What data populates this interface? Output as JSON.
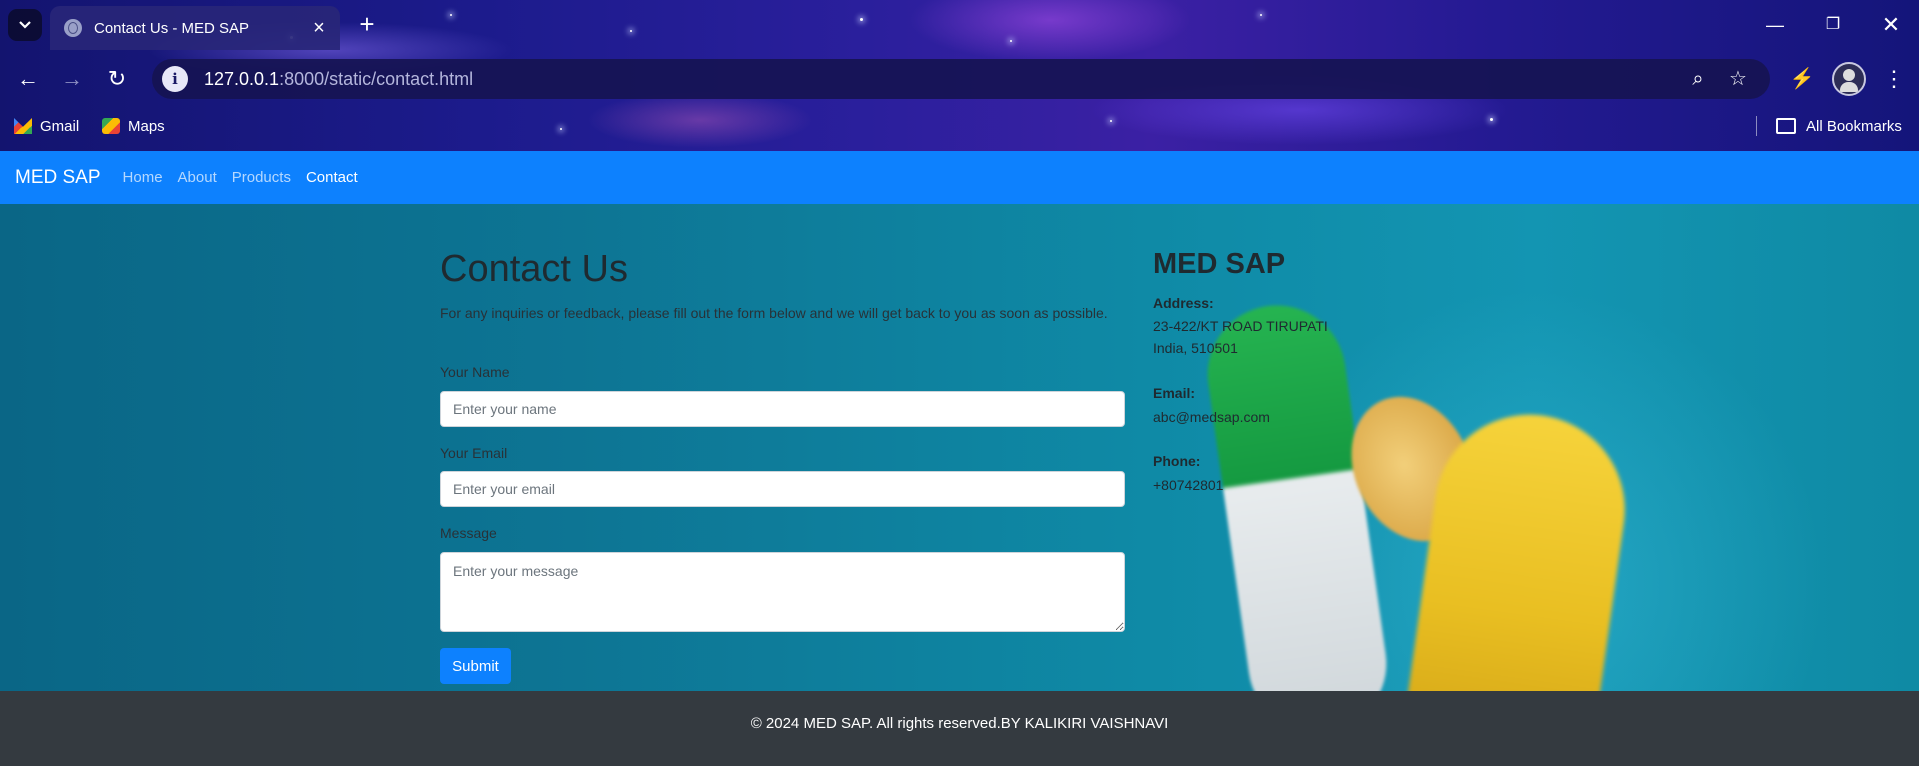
{
  "browser": {
    "tab": {
      "title": "Contact Us - MED SAP"
    },
    "address": {
      "host": "127.0.0.1",
      "rest": ":8000/static/contact.html"
    },
    "bookmarks": [
      {
        "label": "Gmail",
        "icon": "gmail-icon"
      },
      {
        "label": "Maps",
        "icon": "maps-icon"
      }
    ],
    "all_bookmarks_label": "All Bookmarks"
  },
  "navbar": {
    "brand": "MED SAP",
    "links": [
      "Home",
      "About",
      "Products",
      "Contact"
    ],
    "active": "Contact",
    "color": "#0d81fe"
  },
  "contact": {
    "title": "Contact Us",
    "intro": "For any inquiries or feedback, please fill out the form below and we will get back to you as soon as possible.",
    "name_label": "Your Name",
    "name_placeholder": "Enter your name",
    "email_label": "Your Email",
    "email_placeholder": "Enter your email",
    "message_label": "Message",
    "message_placeholder": "Enter your message",
    "submit_label": "Submit"
  },
  "info": {
    "title": "MED SAP",
    "address_label": "Address:",
    "address_line1": "23-422/KT ROAD TIRUPATI",
    "address_line2": "India, 510501",
    "email_label": "Email:",
    "email_value": "abc@medsap.com",
    "phone_label": "Phone:",
    "phone_value": "+80742801"
  },
  "footer": {
    "text": "© 2024 MED SAP. All rights reserved.BY KALIKIRI VAISHNAVI"
  }
}
